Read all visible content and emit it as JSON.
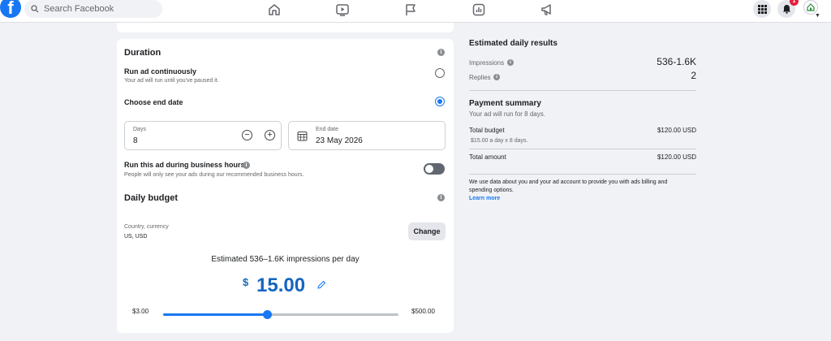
{
  "nav": {
    "search_placeholder": "Search Facebook",
    "logo_letter": "f",
    "notification_count": "1",
    "icons": [
      "home-icon",
      "watch-icon",
      "pages-flag-icon",
      "ads-manager-icon",
      "megaphone-icon",
      "menu-grid-icon",
      "bell-icon"
    ],
    "brand_color": "#1877f2"
  },
  "duration": {
    "title": "Duration",
    "run_continuously_label": "Run ad continuously",
    "run_continuously_desc": "Your ad will run until you've paused it.",
    "choose_end_date_label": "Choose end date",
    "selected_option": "choose_end_date",
    "days_label": "Days",
    "days_value": "8",
    "end_date_label": "End date",
    "end_date_value": "23 May 2026",
    "business_hours_label": "Run this ad during business hours",
    "business_hours_desc": "People will only see your ads during our recommended business hours.",
    "business_hours_enabled": false
  },
  "budget": {
    "title": "Daily budget",
    "country_currency_label": "Country, currency",
    "country_currency_value": "US, USD",
    "change_label": "Change",
    "estimate_text": "Estimated 536–1.6K impressions per day",
    "currency_symbol": "$",
    "amount": "15.00",
    "slider_min": "$3.00",
    "slider_max": "$500.00",
    "slider_fraction": 0.44
  },
  "results": {
    "title": "Estimated daily results",
    "impressions_label": "Impressions",
    "impressions_value": "536-1.6K",
    "replies_label": "Replies",
    "replies_value": "2"
  },
  "payment": {
    "title": "Payment summary",
    "subtitle": "Your ad will run for 8 days.",
    "total_budget_label": "Total budget",
    "total_budget_value": "$120.00 USD",
    "total_budget_detail": "$15.00 a day x 8 days.",
    "total_amount_label": "Total amount",
    "total_amount_value": "$120.00 USD",
    "disclaimer": "We use data about you and your ad account to provide you with ads billing and spending options.",
    "learn_more": "Learn more"
  }
}
